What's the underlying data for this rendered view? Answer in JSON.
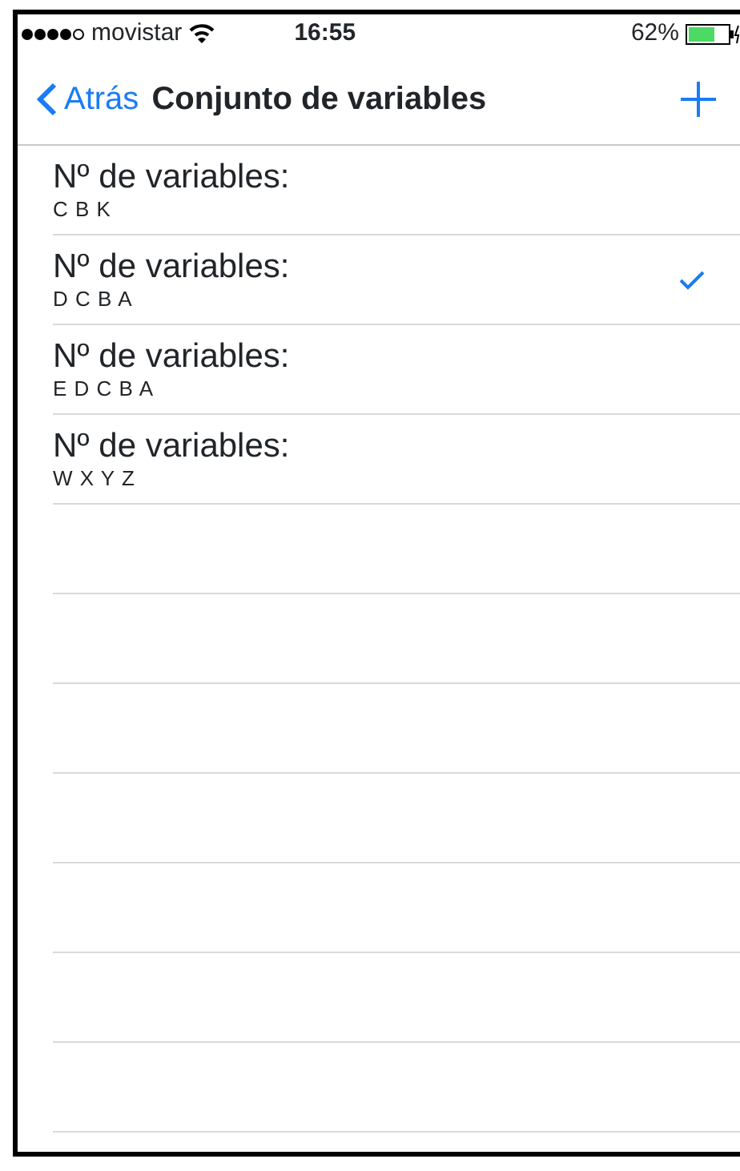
{
  "status_bar": {
    "carrier": "movistar",
    "time": "16:55",
    "battery": "62%"
  },
  "nav_bar": {
    "back": "Atrás",
    "title": "Conjunto de variables"
  },
  "rows": [
    {
      "title": "Nº de variables:",
      "subtitle": "C B K",
      "selected": false
    },
    {
      "title": "Nº de variables:",
      "subtitle": "D C B A",
      "selected": true
    },
    {
      "title": "Nº de variables:",
      "subtitle": "E D C B A",
      "selected": false
    },
    {
      "title": "Nº de variables:",
      "subtitle": "W X Y Z",
      "selected": false
    }
  ]
}
